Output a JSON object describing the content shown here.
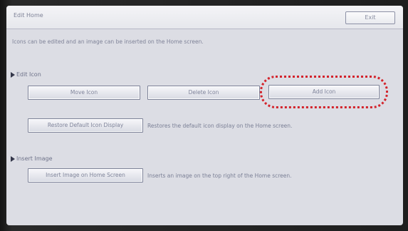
{
  "window": {
    "title": "Edit Home",
    "exit_label": "Exit"
  },
  "info_text": "Icons can be edited and an image can be inserted on the Home screen.",
  "edit_icon": {
    "heading": "Edit Icon",
    "move_label": "Move Icon",
    "delete_label": "Delete Icon",
    "add_label": "Add Icon",
    "restore_label": "Restore Default Icon Display",
    "restore_desc": "Restores the default icon display on the Home screen."
  },
  "insert_image": {
    "heading": "Insert Image",
    "button_label": "Insert Image on Home Screen",
    "desc": "Inserts an image on the top right of the Home screen."
  },
  "colors": {
    "highlight": "#d3242c",
    "screen_bg": "#dcdde4"
  }
}
